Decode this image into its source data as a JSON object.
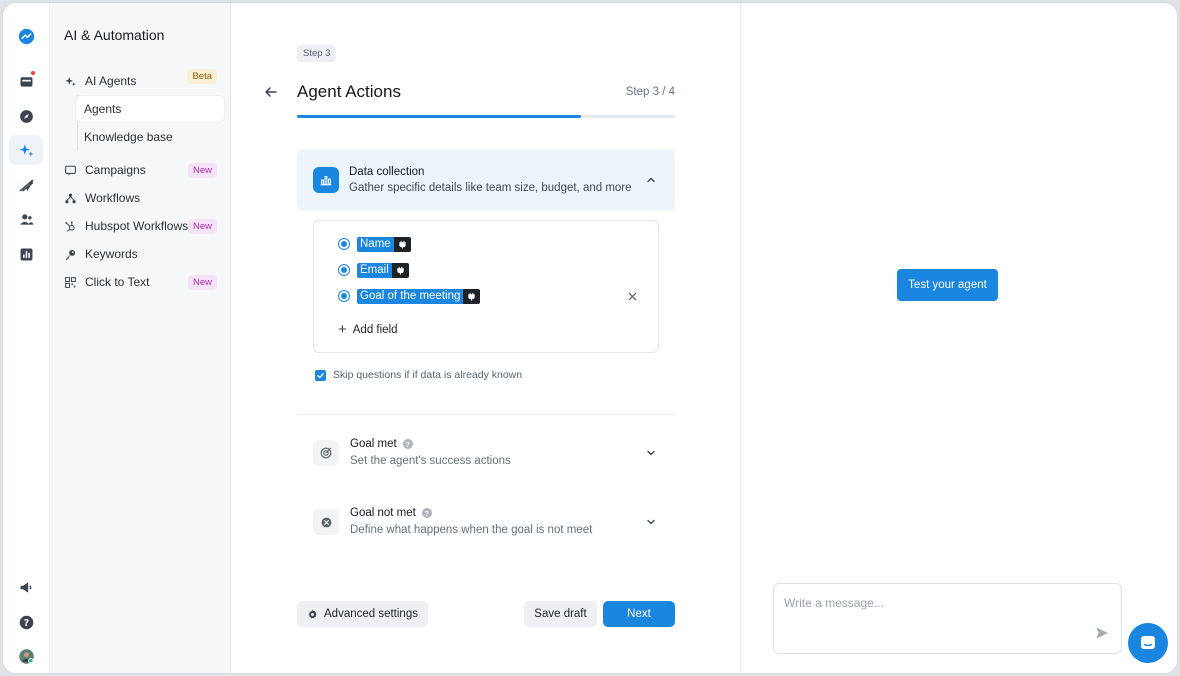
{
  "rail": {
    "items": [
      {
        "icon": "logo-icon"
      },
      {
        "icon": "inbox-icon"
      },
      {
        "icon": "compass-icon"
      },
      {
        "icon": "sparkles-icon"
      },
      {
        "icon": "send-icon"
      },
      {
        "icon": "contacts-icon"
      },
      {
        "icon": "chart-icon"
      },
      {
        "icon": "megaphone-icon"
      },
      {
        "icon": "help-icon"
      },
      {
        "icon": "avatar"
      }
    ]
  },
  "sidebar": {
    "title": "AI & Automation",
    "ai_agents": {
      "label": "AI Agents",
      "badge": "Beta"
    },
    "sub_items": [
      {
        "label": "Agents"
      },
      {
        "label": "Knowledge base"
      }
    ],
    "items": [
      {
        "label": "Campaigns",
        "badge": "New"
      },
      {
        "label": "Workflows"
      },
      {
        "label": "Hubspot Workflows",
        "badge": "New"
      },
      {
        "label": "Keywords"
      },
      {
        "label": "Click to Text",
        "badge": "New"
      }
    ]
  },
  "main": {
    "step_tag": "Step 3",
    "title": "Agent Actions",
    "step_count": "Step 3 / 4",
    "progress": 0.75,
    "data_collection": {
      "title": "Data collection",
      "subtitle": "Gather specific details like team size, budget, and more",
      "fields": [
        {
          "label": "Name"
        },
        {
          "label": "Email"
        },
        {
          "label": "Goal of the meeting"
        }
      ],
      "add_field": "Add field",
      "skip_label": "Skip questions if if data is already known"
    },
    "goal_met": {
      "title": "Goal met",
      "subtitle": "Set the agent's success actions"
    },
    "goal_not_met": {
      "title": "Goal not met",
      "subtitle": "Define what happens when the goal is not meet"
    },
    "buttons": {
      "advanced": "Advanced settings",
      "save_draft": "Save draft",
      "next": "Next"
    }
  },
  "chat": {
    "test_button": "Test your agent",
    "input_placeholder": "Write a message..."
  },
  "colors": {
    "accent": "#1a86e0",
    "sidebar_bg": "#f6f7f9",
    "badge_new": "#b02fb0",
    "badge_beta": "#8a5a00"
  }
}
